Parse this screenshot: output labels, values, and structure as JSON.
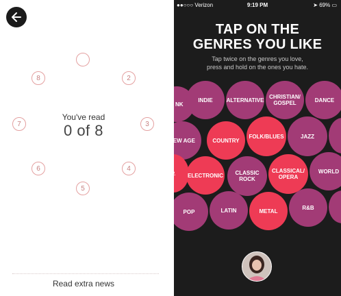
{
  "left": {
    "ring_numbers": [
      "8",
      "2",
      "7",
      "3",
      "6",
      "4",
      "5"
    ],
    "read_label": "You've read",
    "read_count": "0 of 8",
    "extra_link": "Read extra news"
  },
  "right": {
    "status": {
      "carrier": "●●○○○ Verizon",
      "time": "9:19 PM",
      "battery": "69%"
    },
    "headline_line1": "TAP ON THE",
    "headline_line2": "GENRES YOU LIKE",
    "sub_line1": "Tap twice on the genres you love,",
    "sub_line2": "press and hold on the ones you hate.",
    "genres": [
      "E NK",
      "INDIE",
      "ALTERNATIVE",
      "CHRISTIAN/ GOSPEL",
      "DANCE",
      "NEW AGE",
      "COUNTRY",
      "FOLK/BLUES",
      "JAZZ",
      "P.",
      "ELECTRONIC",
      "CLASSIC ROCK",
      "CLASSICAL/ OPERA",
      "WORLD",
      "POP",
      "LATIN",
      "METAL",
      "R&B"
    ],
    "colors": {
      "purple": "#a23b76",
      "red": "#ee3b55",
      "background": "#1c1c1c"
    }
  }
}
